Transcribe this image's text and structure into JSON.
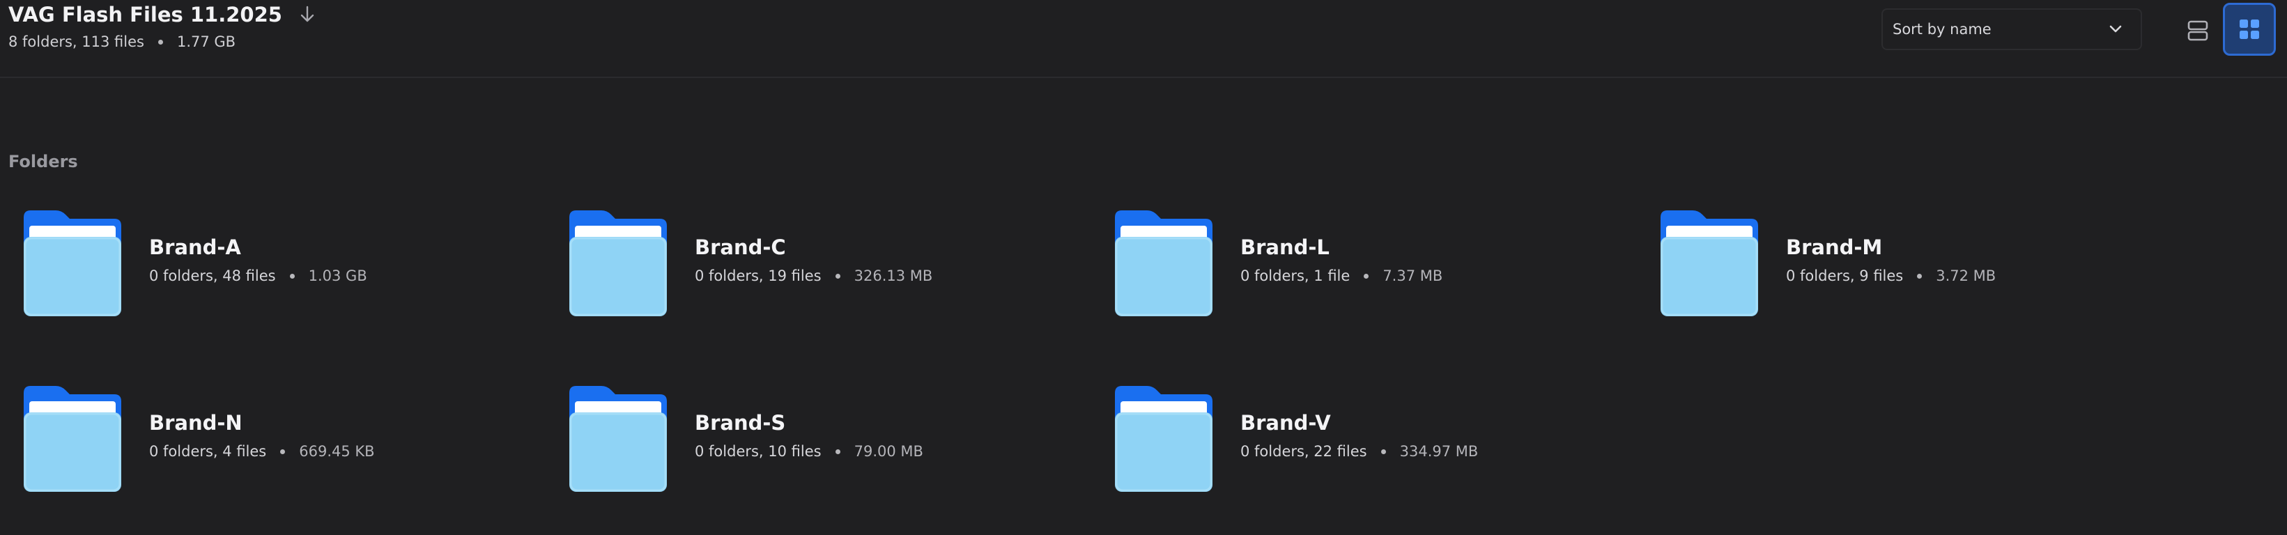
{
  "header": {
    "title": "VAG Flash Files 11.2025",
    "summary_counts": "8 folders, 113 files",
    "summary_size": "1.77 GB",
    "sort_label": "Sort by name",
    "active_view": "grid",
    "accent_color": "#2d6bd3"
  },
  "section": {
    "folders_label": "Folders"
  },
  "folders": [
    {
      "name": "Brand-A",
      "counts": "0 folders, 48 files",
      "size": "1.03 GB"
    },
    {
      "name": "Brand-C",
      "counts": "0 folders, 19 files",
      "size": "326.13 MB"
    },
    {
      "name": "Brand-L",
      "counts": "0 folders, 1 file",
      "size": "7.37 MB"
    },
    {
      "name": "Brand-M",
      "counts": "0 folders, 9 files",
      "size": "3.72 MB"
    },
    {
      "name": "Brand-N",
      "counts": "0 folders, 4 files",
      "size": "669.45 KB"
    },
    {
      "name": "Brand-S",
      "counts": "0 folders, 10 files",
      "size": "79.00 MB"
    },
    {
      "name": "Brand-V",
      "counts": "0 folders, 22 files",
      "size": "334.97 MB"
    }
  ]
}
